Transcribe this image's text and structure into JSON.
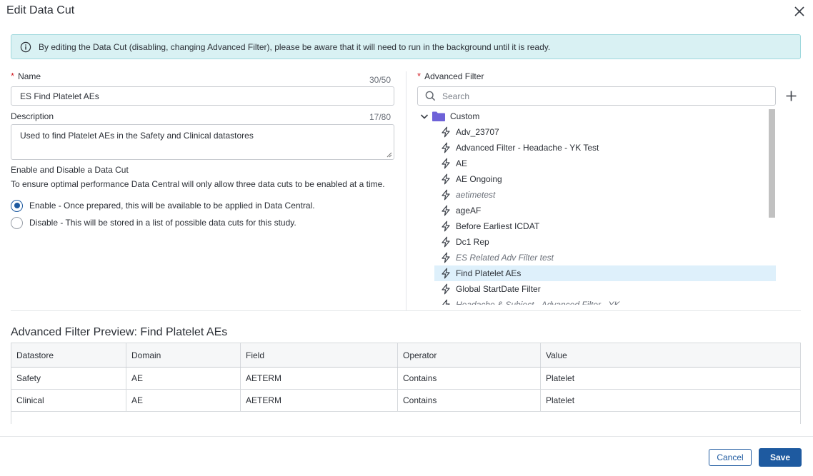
{
  "dialog": {
    "title": "Edit Data Cut",
    "close_icon": "close-icon"
  },
  "alert": {
    "icon": "info-icon",
    "text": "By editing the Data Cut (disabling, changing Advanced Filter), please be aware that it will need to run in the background until it is ready."
  },
  "form": {
    "name": {
      "required_mark": "*",
      "label": "Name",
      "counter": "30/50",
      "value": "ES Find Platelet AEs"
    },
    "description": {
      "label": "Description",
      "counter": "17/80",
      "value": "Used to find Platelet AEs in the Safety and Clinical datastores"
    },
    "enable_section": {
      "heading": "Enable and Disable a Data Cut",
      "description": "To ensure optimal performance Data Central will only allow three data cuts to be enabled at a time.",
      "options": [
        {
          "label": "Enable - Once prepared, this will be available to be applied in Data Central.",
          "checked": true
        },
        {
          "label": "Disable - This will be stored in a list of possible data cuts for this study.",
          "checked": false
        }
      ]
    }
  },
  "advanced_filter": {
    "required_mark": "*",
    "label": "Advanced Filter",
    "search_placeholder": "Search",
    "add_icon": "plus-icon",
    "folder": {
      "label": "Custom",
      "expanded": true,
      "color": "#6e62d8"
    },
    "items": [
      {
        "label": "Adv_23707",
        "italic": false,
        "selected": false
      },
      {
        "label": "Advanced Filter - Headache - YK Test",
        "italic": false,
        "selected": false
      },
      {
        "label": "AE",
        "italic": false,
        "selected": false
      },
      {
        "label": "AE Ongoing",
        "italic": false,
        "selected": false
      },
      {
        "label": "aetimetest",
        "italic": true,
        "selected": false
      },
      {
        "label": "ageAF",
        "italic": false,
        "selected": false
      },
      {
        "label": "Before Earliest ICDAT",
        "italic": false,
        "selected": false
      },
      {
        "label": "Dc1 Rep",
        "italic": false,
        "selected": false
      },
      {
        "label": "ES Related Adv Filter test",
        "italic": true,
        "selected": false
      },
      {
        "label": "Find Platelet AEs",
        "italic": false,
        "selected": true
      },
      {
        "label": "Global StartDate Filter",
        "italic": false,
        "selected": false
      },
      {
        "label": "Headache & Subject - Advanced Filter - YK",
        "italic": true,
        "selected": false
      }
    ]
  },
  "preview": {
    "title": "Advanced Filter Preview: Find Platelet AEs",
    "columns": [
      "Datastore",
      "Domain",
      "Field",
      "Operator",
      "Value"
    ],
    "rows": [
      [
        "Safety",
        "AE",
        "AETERM",
        "Contains",
        "Platelet"
      ],
      [
        "Clinical",
        "AE",
        "AETERM",
        "Contains",
        "Platelet"
      ]
    ]
  },
  "footer": {
    "cancel_label": "Cancel",
    "save_label": "Save"
  },
  "colors": {
    "accent": "#1e5aa0",
    "alert_bg": "#d9f1f3",
    "selected_bg": "#def0fb",
    "required": "#d3242c"
  }
}
